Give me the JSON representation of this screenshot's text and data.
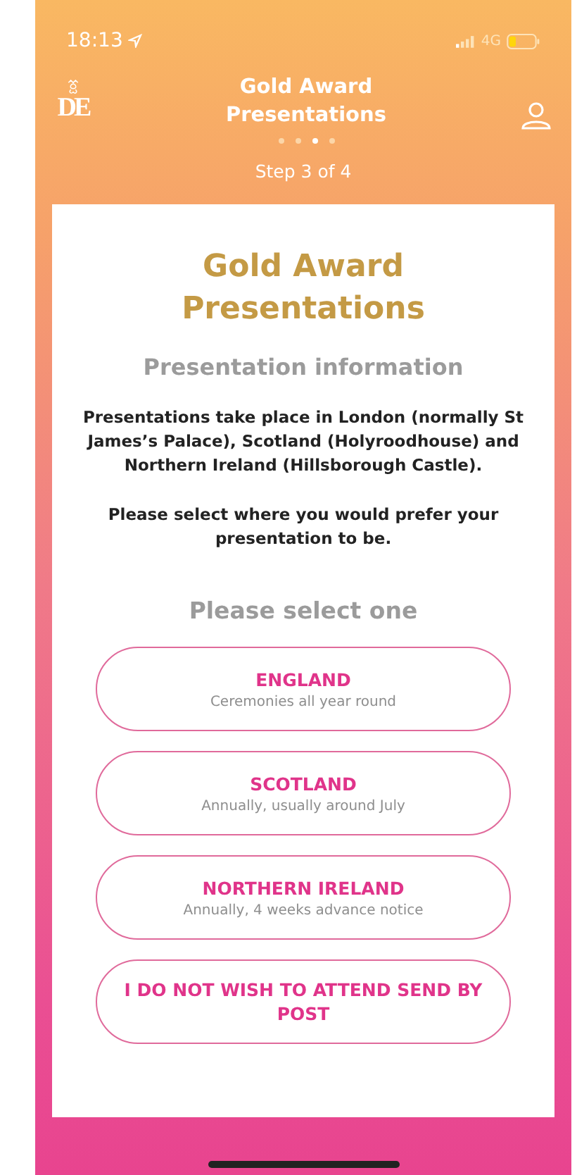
{
  "status_bar": {
    "time": "18:13",
    "network": "4G"
  },
  "header": {
    "logo": "DE",
    "title": "Gold Award Presentations",
    "pages": [
      {
        "selected": false
      },
      {
        "selected": false
      },
      {
        "selected": true
      },
      {
        "selected": false
      }
    ],
    "step": "Step 3 of 4"
  },
  "card": {
    "title": "Gold Award Presentations",
    "subtitle": "Presentation information",
    "paragraphs": [
      "Presentations take place in London (normally St James’s Palace), Scotland (Holyroodhouse) and Northern Ireland (Hillsborough Castle).",
      "Please select where you would prefer your presentation to be."
    ],
    "prompt": "Please select one",
    "options": [
      {
        "label": "ENGLAND",
        "detail": "Ceremonies all year round",
        "selected": false
      },
      {
        "label": "SCOTLAND",
        "detail": "Annually, usually around July",
        "selected": false
      },
      {
        "label": "NORTHERN IRELAND",
        "detail": "Annually, 4 weeks advance notice",
        "selected": false
      },
      {
        "label": "I DO NOT WISH TO ATTEND SEND BY POST",
        "selected": false
      }
    ]
  }
}
